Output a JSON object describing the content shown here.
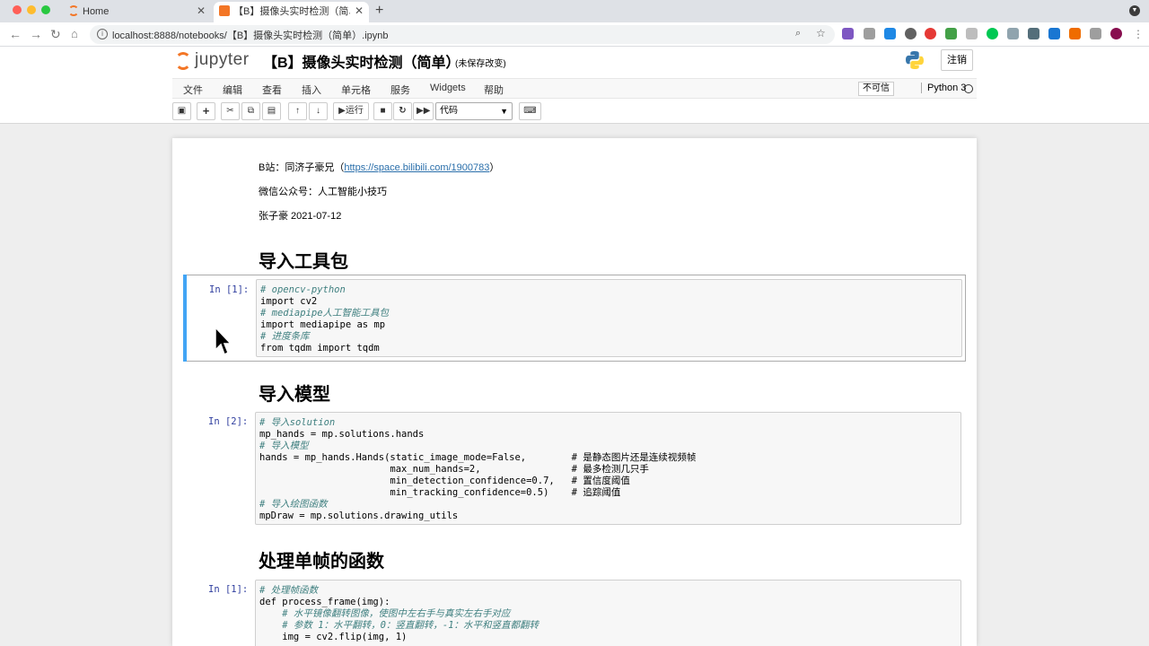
{
  "browser": {
    "tabs": [
      {
        "title": "Home",
        "active": false
      },
      {
        "title": "【B】摄像头实时检测（简单）-",
        "active": true
      }
    ],
    "url": "localhost:8888/notebooks/【B】摄像头实时检测（简单）.ipynb",
    "colors": {
      "traffic_red": "#ff5f57",
      "traffic_yellow": "#febc2e",
      "traffic_green": "#28c840"
    }
  },
  "header": {
    "logo_text": "jupyter",
    "notebook_title": "【B】摄像头实时检测（简单）",
    "save_status": "(未保存改变)",
    "logout_label": "注销"
  },
  "menubar": {
    "items": [
      "文件",
      "编辑",
      "查看",
      "插入",
      "单元格",
      "服务",
      "Widgets",
      "帮助"
    ],
    "trusted_label": "不可信",
    "kernel_name": "Python 3"
  },
  "toolbar": {
    "run_label": "运行",
    "cell_type": "代码",
    "icons": [
      "save-icon",
      "plus-icon",
      "cut-icon",
      "copy-icon",
      "paste-icon",
      "arrow-up-icon",
      "arrow-down-icon",
      "run-icon",
      "stop-icon",
      "restart-icon",
      "fast-forward-icon",
      "keyboard-icon"
    ]
  },
  "notebook": {
    "intro": {
      "bilibili_prefix": "B站：同济子豪兄（",
      "bilibili_link": "https://space.bilibili.com/1900783",
      "bilibili_suffix": "）",
      "wechat": "微信公众号：人工智能小技巧",
      "author_date": "张子豪 2021-07-12"
    },
    "headings": [
      "导入工具包",
      "导入模型",
      "处理单帧的函数"
    ],
    "cells": [
      {
        "prompt": "In [1]:",
        "lines": [
          "# opencv-python",
          "import cv2",
          "# mediapipe人工智能工具包",
          "import mediapipe as mp",
          "# 进度条库",
          "from tqdm import tqdm"
        ]
      },
      {
        "prompt": "In [2]:",
        "lines": [
          "# 导入solution",
          "mp_hands = mp.solutions.hands",
          "# 导入模型",
          "hands = mp_hands.Hands(static_image_mode=False,        # 是静态图片还是连续视频帧",
          "                       max_num_hands=2,                # 最多检测几只手",
          "                       min_detection_confidence=0.7,   # 置信度阈值",
          "                       min_tracking_confidence=0.5)    # 追踪阈值",
          "# 导入绘图函数",
          "mpDraw = mp.solutions.drawing_utils"
        ]
      },
      {
        "prompt": "In [1]:",
        "lines": [
          "# 处理帧函数",
          "def process_frame(img):",
          "    # 水平镜像翻转图像，使图中左右手与真实左右手对应",
          "    # 参数 1：水平翻转，0：竖直翻转，-1：水平和竖直都翻转",
          "    img = cv2.flip(img, 1)"
        ]
      }
    ]
  }
}
